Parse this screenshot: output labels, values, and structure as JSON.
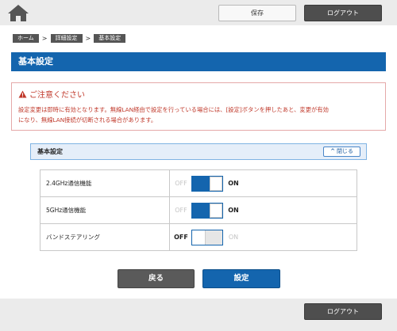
{
  "header": {
    "save_label": "保存",
    "logout_label": "ログアウト"
  },
  "breadcrumb": [
    "ホーム",
    "詳細設定",
    "基本設定"
  ],
  "page_title": "基本設定",
  "caution": {
    "title": "ご注意ください",
    "text_line1": "設定変更は即時に有効となります。無線LAN経由で設定を行っている場合には、[設定]ボタンを押したあと、変更が有効",
    "text_line2": "になり、無線LAN接続が切断される場合があります。"
  },
  "panel": {
    "title": "基本設定",
    "close_label": "閉じる"
  },
  "settings": [
    {
      "label": "2.4GHz通信機能",
      "off_label": "OFF",
      "on_label": "ON",
      "state": "on"
    },
    {
      "label": "5GHz通信機能",
      "off_label": "OFF",
      "on_label": "ON",
      "state": "on"
    },
    {
      "label": "バンドステアリング",
      "off_label": "OFF",
      "on_label": "ON",
      "state": "off"
    }
  ],
  "actions": {
    "back_label": "戻る",
    "set_label": "設定"
  },
  "footer": {
    "logout_label": "ログアウト"
  },
  "colors": {
    "accent": "#1465ae",
    "caution": "#c0392b"
  }
}
